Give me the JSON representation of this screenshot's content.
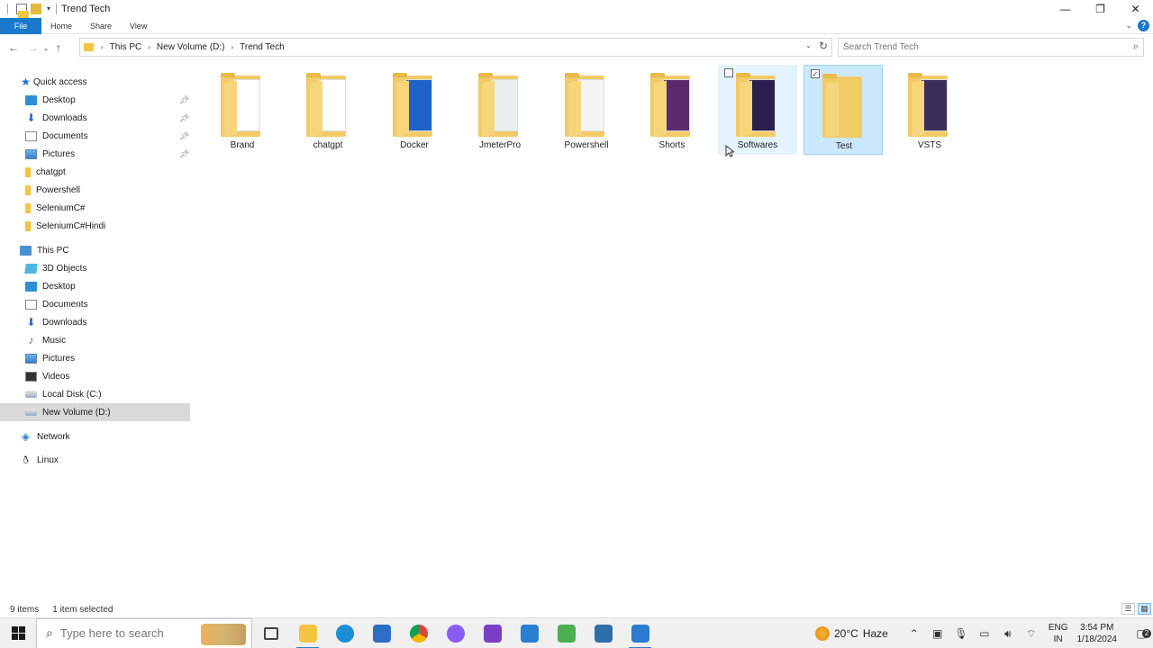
{
  "window": {
    "title": "Trend Tech",
    "controls": {
      "minimize": "—",
      "maximize": "❐",
      "close": "✕"
    }
  },
  "ribbon": {
    "tabs": [
      "File",
      "Home",
      "Share",
      "View"
    ]
  },
  "address": {
    "breadcrumbs": [
      "This PC",
      "New Volume (D:)",
      "Trend Tech"
    ],
    "search_placeholder": "Search Trend Tech"
  },
  "navpane": {
    "quick_access": {
      "label": "Quick access",
      "items": [
        {
          "label": "Desktop",
          "icon": "desktop-icon",
          "pinned": true
        },
        {
          "label": "Downloads",
          "icon": "download-icon",
          "pinned": true
        },
        {
          "label": "Documents",
          "icon": "documents-icon",
          "pinned": true
        },
        {
          "label": "Pictures",
          "icon": "pictures-icon",
          "pinned": true
        },
        {
          "label": "chatgpt",
          "icon": "folder-icon",
          "pinned": false
        },
        {
          "label": "Powershell",
          "icon": "folder-icon",
          "pinned": false
        },
        {
          "label": "SeleniumC#",
          "icon": "folder-icon",
          "pinned": false
        },
        {
          "label": "SeleniumC#Hindi",
          "icon": "folder-icon",
          "pinned": false
        }
      ]
    },
    "this_pc": {
      "label": "This PC",
      "items": [
        {
          "label": "3D Objects",
          "icon": "3d-objects-icon"
        },
        {
          "label": "Desktop",
          "icon": "desktop-icon"
        },
        {
          "label": "Documents",
          "icon": "documents-icon"
        },
        {
          "label": "Downloads",
          "icon": "download-icon"
        },
        {
          "label": "Music",
          "icon": "music-icon"
        },
        {
          "label": "Pictures",
          "icon": "pictures-icon"
        },
        {
          "label": "Videos",
          "icon": "videos-icon"
        },
        {
          "label": "Local Disk (C:)",
          "icon": "disk-icon"
        },
        {
          "label": "New Volume (D:)",
          "icon": "disk-icon",
          "selected": true
        }
      ]
    },
    "network": "Network",
    "linux": "Linux"
  },
  "folders": [
    {
      "name": "Brand",
      "state": "normal",
      "thumb": "#ffffff"
    },
    {
      "name": "chatgpt",
      "state": "normal",
      "thumb": "#ffffff"
    },
    {
      "name": "Docker",
      "state": "normal",
      "thumb": "#1d63c9"
    },
    {
      "name": "JmeterPro",
      "state": "normal",
      "thumb": "#e8f0ee"
    },
    {
      "name": "Powershell",
      "state": "normal",
      "thumb": "#f4f4f4"
    },
    {
      "name": "Shorts",
      "state": "normal",
      "thumb": "#5b2a6e"
    },
    {
      "name": "Softwares",
      "state": "hover",
      "thumb": "#2a1f4e"
    },
    {
      "name": "Test",
      "state": "selected",
      "thumb": "#f7d57a"
    },
    {
      "name": "VSTS",
      "state": "normal",
      "thumb": "#3b2f5a"
    }
  ],
  "status": {
    "item_count": "9 items",
    "selection": "1 item selected"
  },
  "taskbar": {
    "search_placeholder": "Type here to search",
    "apps": [
      {
        "name": "task-view",
        "color": "#444444"
      },
      {
        "name": "file-explorer",
        "color": "#f4c542",
        "active": true
      },
      {
        "name": "edge",
        "color": "#1b8fd6"
      },
      {
        "name": "mail",
        "color": "#2a6fc4"
      },
      {
        "name": "chrome",
        "color": "#db4437"
      },
      {
        "name": "copilot",
        "color": "#8a5cf6"
      },
      {
        "name": "visual-studio",
        "color": "#7b3fc6"
      },
      {
        "name": "vscode",
        "color": "#2a7fd0"
      },
      {
        "name": "notepad-plus",
        "color": "#4caf50"
      },
      {
        "name": "powershell",
        "color": "#2f6ea8"
      },
      {
        "name": "remote-desktop",
        "color": "#2d7bd0",
        "active": true
      }
    ],
    "weather": {
      "temp": "20°C",
      "condition": "Haze"
    },
    "language": {
      "line1": "ENG",
      "line2": "IN"
    },
    "clock": {
      "time": "3:54 PM",
      "date": "1/18/2024"
    },
    "notifications": "2"
  }
}
